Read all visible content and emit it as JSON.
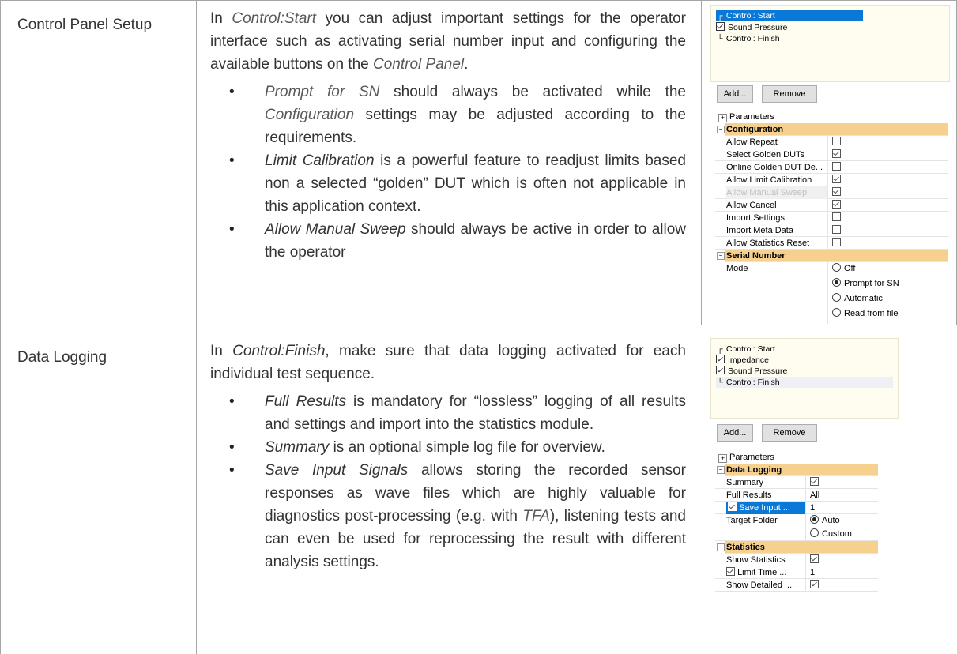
{
  "rows": [
    {
      "label": "Control Panel Setup",
      "intro": {
        "p1": "In ",
        "em1": "Control:Start",
        "p2": " you can adjust important settings for the operator interface such as activating serial number input and configuring the available buttons on the ",
        "em2": "Control Panel",
        "p3": "."
      },
      "bullets": [
        {
          "em": "Prompt for SN",
          "t1": " should always be activated while the ",
          "em2": "Configuration",
          "t2": " settings may be adjusted according to the requirements."
        },
        {
          "em": "Limit Calibration",
          "t1": " is a powerful feature to readjust limits based non a selected “golden” DUT which is often not applicable in this application context."
        },
        {
          "em": "Allow Manual Sweep",
          "t1": " should always be active in order to allow the operator"
        }
      ]
    },
    {
      "label": "Data Logging",
      "intro": {
        "p1": "In ",
        "em1": "Control:Finish",
        "p2": ", make sure that data logging activated for each individual test sequence."
      },
      "bullets": [
        {
          "em": "Full Results",
          "t1": " is mandatory for “lossless” logging of all results and settings and import into the statistics module."
        },
        {
          "em": "Summary",
          "t1": " is an optional simple log file for overview."
        },
        {
          "em": "Save Input Signals",
          "t1": " allows storing the recorded sensor responses as wave files which are highly valuable for diagnostics post-processing (e.g. with ",
          "em2": "TFA",
          "t2": "), listening tests and can even be used for reprocessing the result with different analysis settings."
        }
      ]
    }
  ],
  "panel1": {
    "tree": [
      "Control: Start",
      "Sound Pressure",
      "Control: Finish"
    ],
    "buttons": {
      "add": "Add...",
      "remove": "Remove"
    },
    "parameters_label": "Parameters",
    "sections": [
      {
        "title": "Configuration",
        "items": [
          {
            "name": "Allow Repeat",
            "checked": false
          },
          {
            "name": "Select Golden DUTs",
            "checked": true
          },
          {
            "name": "Online Golden DUT De...",
            "checked": false
          },
          {
            "name": "Allow Limit Calibration",
            "checked": true
          },
          {
            "name": "Allow Manual Sweep",
            "checked": true
          },
          {
            "name": "Allow Cancel",
            "checked": true
          },
          {
            "name": "Import Settings",
            "checked": false
          },
          {
            "name": "Import Meta Data",
            "checked": false
          },
          {
            "name": "Allow Statistics Reset",
            "checked": false
          }
        ]
      },
      {
        "title": "Serial Number",
        "mode_label": "Mode",
        "options": [
          "Off",
          "Prompt for SN",
          "Automatic",
          "Read from file"
        ],
        "selected": 1
      }
    ]
  },
  "panel2": {
    "tree": [
      "Control: Start",
      "Impedance",
      "Sound Pressure",
      "Control: Finish"
    ],
    "buttons": {
      "add": "Add...",
      "remove": "Remove"
    },
    "parameters_label": "Parameters",
    "data_logging": {
      "title": "Data Logging",
      "summary": "Summary",
      "full_results": "Full Results",
      "full_results_value": "All",
      "save_input": "Save Input ...",
      "save_input_value": "1",
      "target_folder": "Target Folder",
      "folder_options": [
        "Auto",
        "Custom"
      ]
    },
    "statistics": {
      "title": "Statistics",
      "show_statistics": "Show Statistics",
      "limit_time": "Limit Time ...",
      "limit_time_value": "1",
      "show_detailed": "Show Detailed ..."
    }
  }
}
